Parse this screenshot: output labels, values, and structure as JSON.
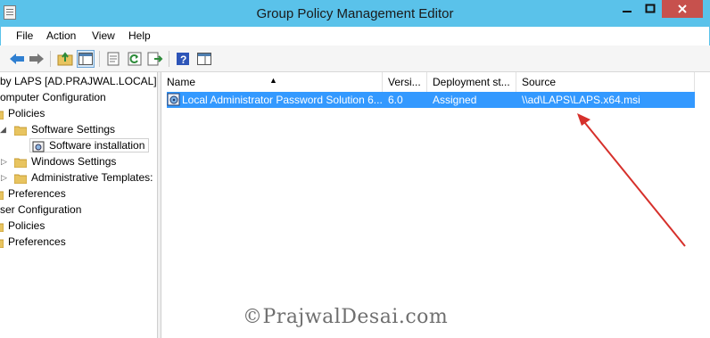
{
  "window": {
    "title": "Group Policy Management Editor"
  },
  "menu": [
    "File",
    "Action",
    "View",
    "Help"
  ],
  "toolbar": {
    "buttons": [
      "back-icon",
      "forward-icon",
      "up-folder-icon",
      "show-hide-tree-icon",
      "properties-icon",
      "refresh-icon",
      "export-list-icon",
      "help-icon",
      "extended-view-icon"
    ]
  },
  "tree": {
    "items": [
      {
        "label": "by LAPS [AD.PRAJWAL.LOCAL] P"
      },
      {
        "label": "omputer Configuration"
      },
      {
        "label": "Policies"
      },
      {
        "label": "Software Settings"
      },
      {
        "label": "Software installation"
      },
      {
        "label": "Windows Settings"
      },
      {
        "label": "Administrative Templates:"
      },
      {
        "label": "Preferences"
      },
      {
        "label": "ser Configuration"
      },
      {
        "label": "Policies"
      },
      {
        "label": "Preferences"
      }
    ]
  },
  "list": {
    "columns": [
      "Name",
      "Versi...",
      "Deployment st...",
      "Source"
    ],
    "rows": [
      {
        "name": "Local Administrator Password Solution 6...",
        "version": "6.0",
        "deployment": "Assigned",
        "source": "\\\\ad\\LAPS\\LAPS.x64.msi"
      }
    ]
  },
  "annotation": {
    "arrow_color": "#d6302b"
  },
  "watermark": "©PrajwalDesai.com"
}
